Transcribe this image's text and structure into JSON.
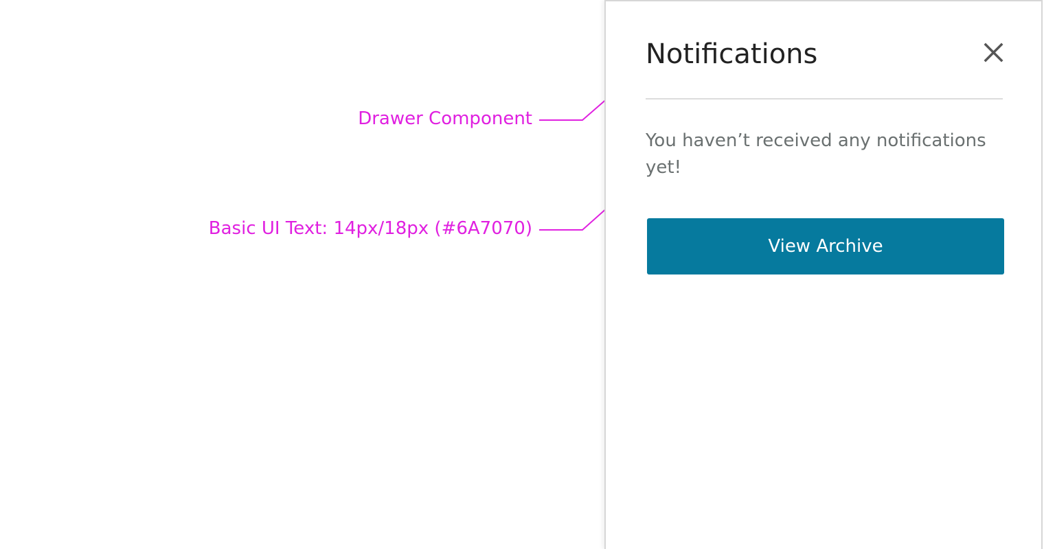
{
  "annotations": [
    {
      "label": "Drawer Component"
    },
    {
      "label": "Basic UI Text: 14px/18px (#6A7070)"
    }
  ],
  "drawer": {
    "title": "Notifications",
    "close_icon": "close-icon",
    "empty_message": "You haven’t received any notifications yet!",
    "button_label": "View Archive"
  },
  "colors": {
    "annotation": "#E020E0",
    "button_bg": "#067A9E",
    "body_text": "#6A7070",
    "title_text": "#222222",
    "close_icon": "#555555"
  }
}
